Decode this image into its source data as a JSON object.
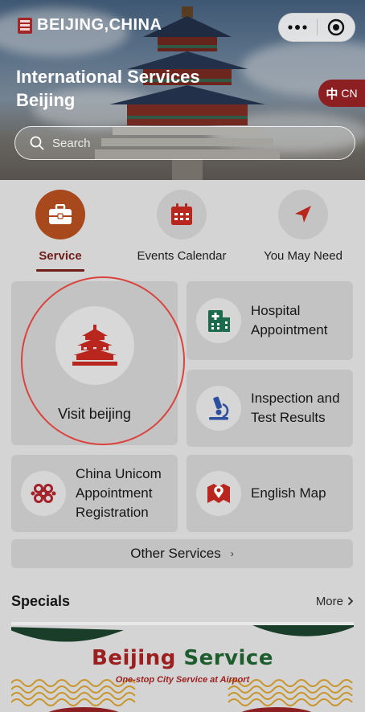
{
  "header": {
    "city": "BEIJING,CHINA",
    "title_line1": "International Services",
    "title_line2": "Beijing",
    "lang_zh": "中",
    "lang_en": "CN",
    "search_placeholder": "Search",
    "capsule_icons": [
      "more-dots-icon",
      "record-target-icon"
    ]
  },
  "tabs": [
    {
      "label": "Service",
      "icon": "briefcase-icon",
      "active": true
    },
    {
      "label": "Events Calendar",
      "icon": "calendar-icon",
      "active": false
    },
    {
      "label": "You May Need",
      "icon": "navigation-arrow-icon",
      "active": false
    }
  ],
  "services": {
    "visit": {
      "label": "Visit beijing",
      "icon": "temple-icon"
    },
    "hospital": {
      "line1": "Hospital",
      "line2": "Appointment",
      "icon": "hospital-icon"
    },
    "inspection": {
      "line1": "Inspection and",
      "line2": "Test Results",
      "icon": "microscope-icon"
    },
    "unicom": {
      "line1": "China Unicom",
      "line2": "Appointment",
      "line3": "Registration",
      "icon": "unicom-knot-icon"
    },
    "map": {
      "label": "English Map",
      "icon": "map-pin-icon"
    }
  },
  "other_services": "Other Services",
  "specials": {
    "heading": "Specials",
    "more": "More",
    "banner_word1": "Beijing",
    "banner_word2": "Service",
    "banner_sub": "One-stop City Service at Airport"
  },
  "colors": {
    "accent_dark_red": "#8c1f22",
    "active_tab": "#a8491d",
    "icon_red": "#b8261d",
    "icon_green": "#1d6b4e",
    "icon_blue": "#2c4fa0",
    "highlight_circle": "#d9443f"
  }
}
